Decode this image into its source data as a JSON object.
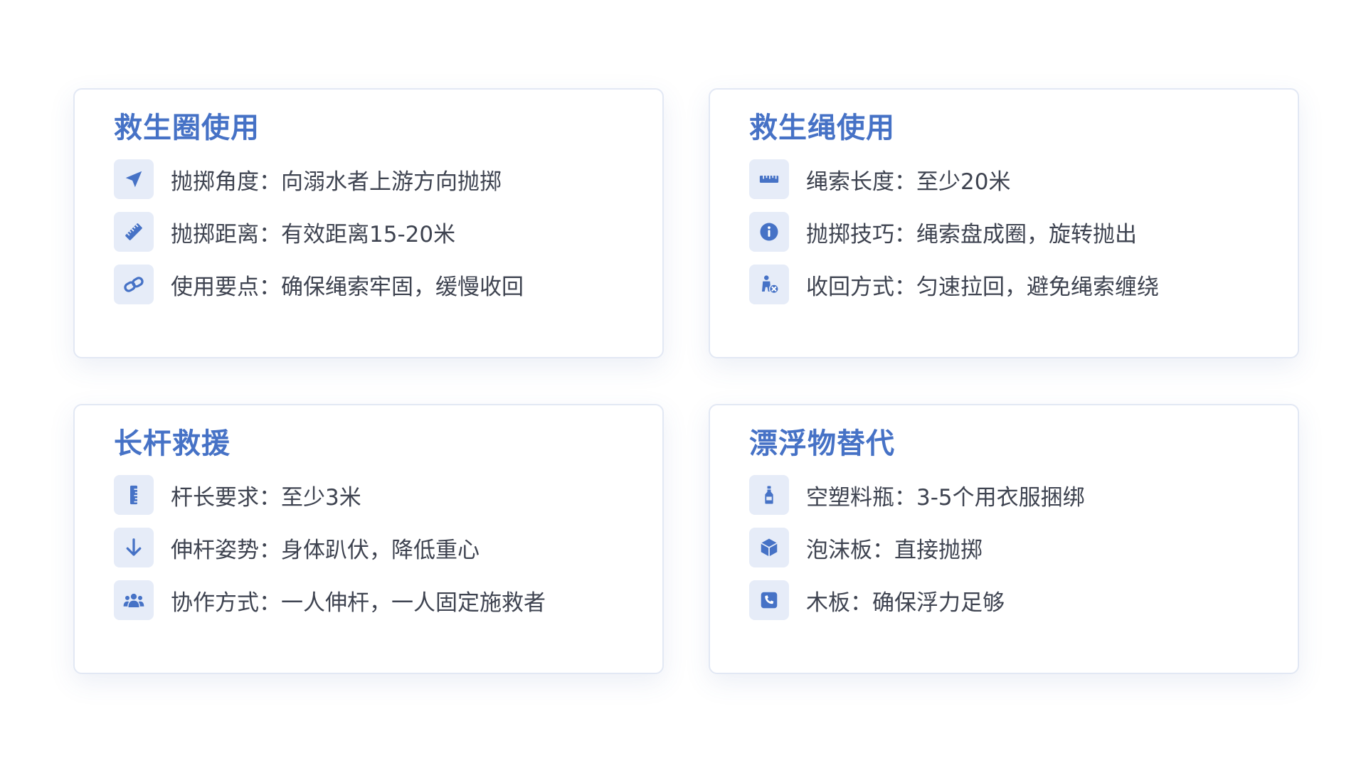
{
  "theme": {
    "accent": "#4672c6",
    "icon_bg": "#e6ecf8",
    "text": "#3e4350",
    "border": "#e2e8f4"
  },
  "cards": [
    {
      "title": "救生圈使用",
      "items": [
        {
          "icon": "paper-plane-icon",
          "text": "抛掷角度：向溺水者上游方向抛掷"
        },
        {
          "icon": "ruler-icon",
          "text": "抛掷距离：有效距离15-20米"
        },
        {
          "icon": "link-icon",
          "text": "使用要点：确保绳索牢固，缓慢收回"
        }
      ]
    },
    {
      "title": "救生绳使用",
      "items": [
        {
          "icon": "ruler-horizontal-icon",
          "text": "绳索长度：至少20米"
        },
        {
          "icon": "info-circle-icon",
          "text": "抛掷技巧：绳索盘成圈，旋转抛出"
        },
        {
          "icon": "person-circle-xmark-icon",
          "text": "收回方式：匀速拉回，避免绳索缠绕"
        }
      ]
    },
    {
      "title": "长杆救援",
      "items": [
        {
          "icon": "ruler-vertical-icon",
          "text": "杆长要求：至少3米"
        },
        {
          "icon": "arrow-down-icon",
          "text": "伸杆姿势：身体趴伏，降低重心"
        },
        {
          "icon": "users-icon",
          "text": "协作方式：一人伸杆，一人固定施救者"
        }
      ]
    },
    {
      "title": "漂浮物替代",
      "items": [
        {
          "icon": "bottle-icon",
          "text": "空塑料瓶：3-5个用衣服捆绑"
        },
        {
          "icon": "cube-icon",
          "text": "泡沫板：直接抛掷"
        },
        {
          "icon": "square-phone-icon",
          "text": "木板：确保浮力足够"
        }
      ]
    }
  ]
}
